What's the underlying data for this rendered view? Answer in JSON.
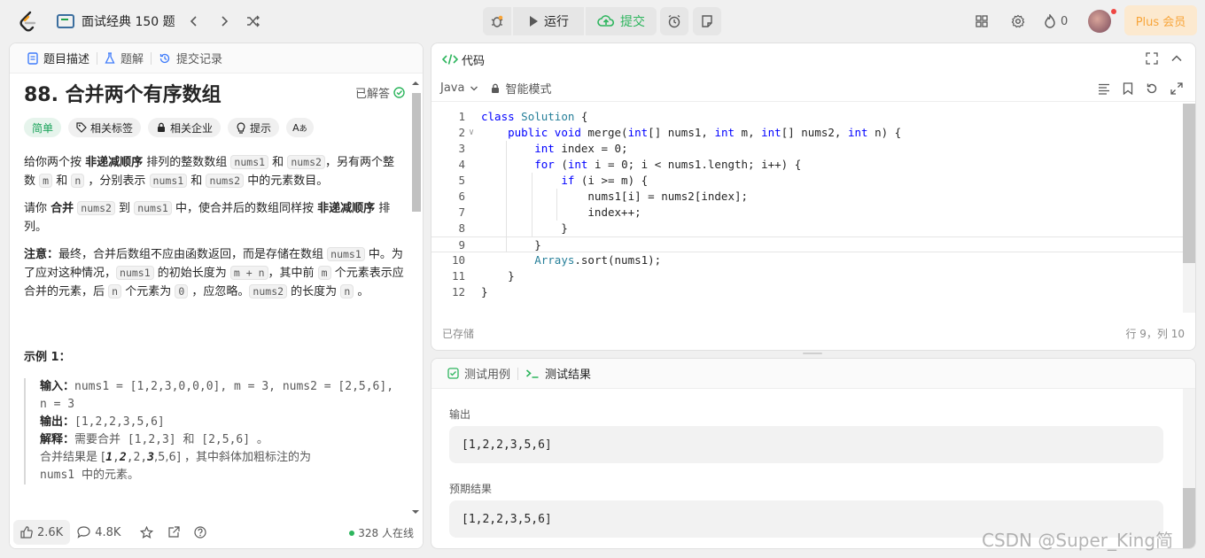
{
  "topbar": {
    "problem_list": "面试经典 150 题",
    "run_label": "运行",
    "submit_label": "提交",
    "points": "0",
    "plus_label": "Plus 会员"
  },
  "left": {
    "tabs": [
      "题目描述",
      "题解",
      "提交记录"
    ],
    "title": "88. 合并两个有序数组",
    "solved": "已解答",
    "tags": [
      "简单",
      "相关标签",
      "相关企业",
      "提示",
      "Aあ"
    ],
    "p1": {
      "a": "给你两个按 ",
      "b": "非递减顺序",
      "c": " 排列的整数数组 ",
      "d": "nums1",
      "e": " 和 ",
      "f": "nums2",
      "g": "，另有两个整数 ",
      "h": "m",
      "i": " 和 ",
      "j": "n",
      "k": " ，分别表示 ",
      "l": "nums1",
      "m2": " 和 ",
      "n2": "nums2",
      "o": " 中的元素数目。"
    },
    "p2": {
      "a": "请你 ",
      "b": "合并",
      "c": " ",
      "d": "nums2",
      "e": " 到 ",
      "f": "nums1",
      "g": " 中，使合并后的数组同样按 ",
      "h": "非递减顺序",
      "i": " 排列。"
    },
    "p3": {
      "a": "注意：",
      "b": "最终，合并后数组不应由函数返回，而是存储在数组 ",
      "c": "nums1",
      "d": " 中。为了应对这种情况，",
      "e": "nums1",
      "f": " 的初始长度为 ",
      "g": "m + n",
      "h": "，其中前 ",
      "i": "m",
      "j": " 个元素表示应合并的元素，后 ",
      "k": "n",
      "l": " 个元素为 ",
      "m2": "0",
      "n2": " ，应忽略。",
      "o": "nums2",
      "p": " 的长度为 ",
      "q": "n",
      "r": " 。"
    },
    "example_title": "示例 1：",
    "example": {
      "input_label": "输入：",
      "input_value": "nums1 = [1,2,3,0,0,0], m = 3, nums2 = [2,5,6], n = 3",
      "output_label": "输出：",
      "output_value": "[1,2,2,3,5,6]",
      "explain_label": "解释：",
      "explain_value": "需要合并 [1,2,3] 和 [2,5,6] 。",
      "merge_a": "合并结果是 [",
      "merge_b1": "1",
      "merge_c": ",",
      "merge_b2": "2",
      "merge_d": ",2,",
      "merge_b3": "3",
      "merge_e": ",5,6] ，其中斜体加粗标注的为",
      "merge_f": "nums1 中的元素。"
    },
    "footer": {
      "likes": "2.6K",
      "comments": "4.8K",
      "online": "328 人在线"
    }
  },
  "editor": {
    "title": "代码",
    "language": "Java",
    "mode": "智能模式",
    "lines": [
      "class Solution {",
      "    public void merge(int[] nums1, int m, int[] nums2, int n) {",
      "        int index = 0;",
      "        for (int i = 0; i < nums1.length; i++) {",
      "            if (i >= m) {",
      "                nums1[i] = nums2[index];",
      "                index++;",
      "            }",
      "        }",
      "        Arrays.sort(nums1);",
      "    }",
      "}"
    ],
    "saved": "已存储",
    "cursor": "行 9，列 10"
  },
  "result": {
    "tabs": [
      "测试用例",
      "测试结果"
    ],
    "output_label": "输出",
    "output_value": "[1,2,2,3,5,6]",
    "expected_label": "预期结果",
    "expected_value": "[1,2,2,3,5,6]"
  },
  "watermark": "CSDN @Super_King简"
}
